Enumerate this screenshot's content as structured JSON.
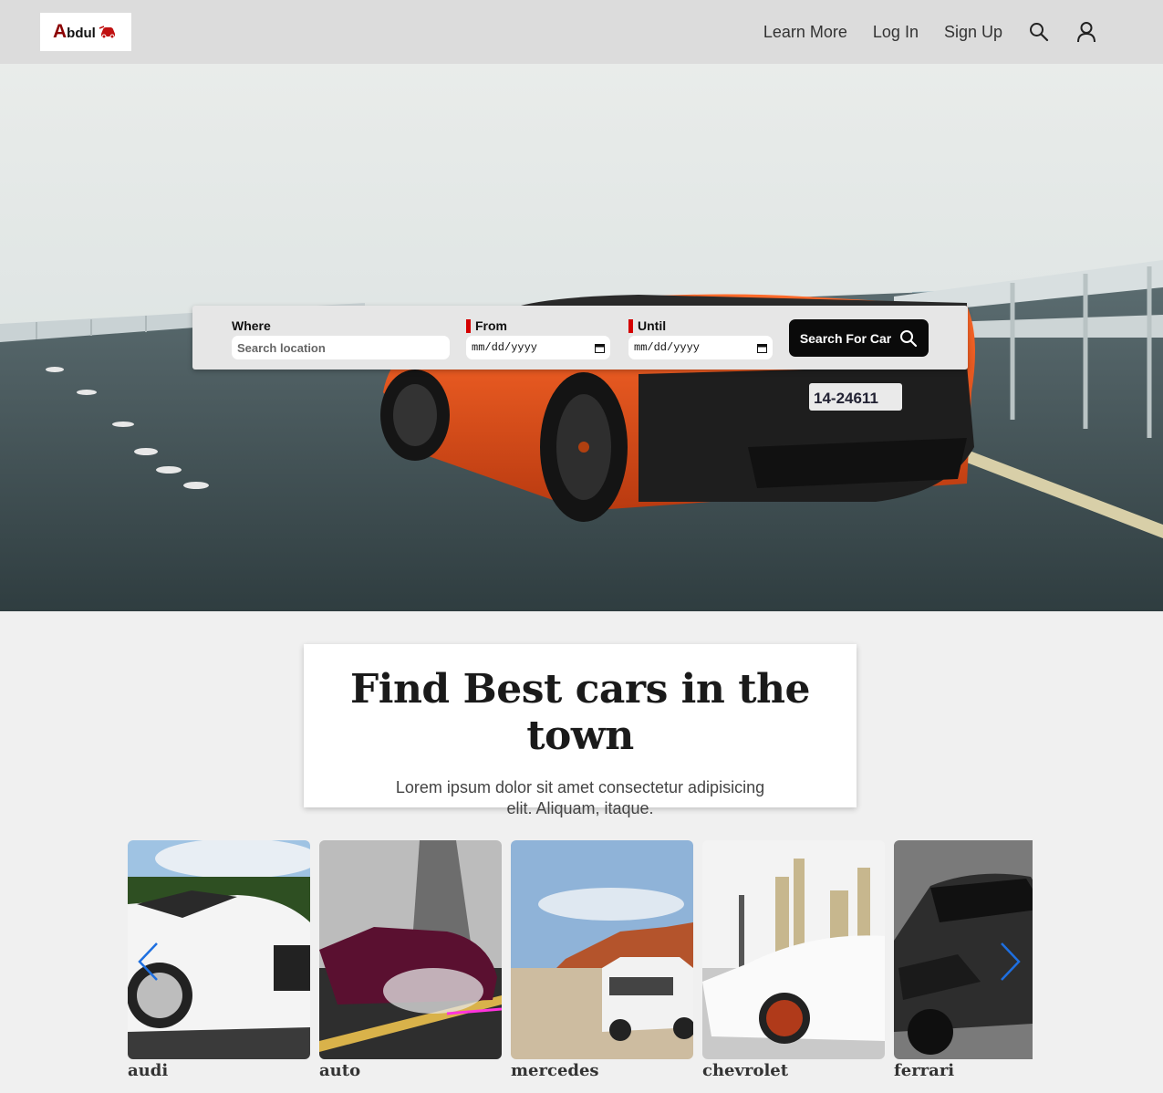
{
  "header": {
    "logo_text": "Abdul",
    "nav": [
      {
        "label": "Learn More"
      },
      {
        "label": "Log In"
      },
      {
        "label": "Sign Up"
      }
    ],
    "icons": [
      "search-icon",
      "user-icon"
    ]
  },
  "search": {
    "where_label": "Where",
    "where_placeholder": "Search location",
    "from_label": "From",
    "from_placeholder": "mm/dd/yyyy",
    "until_label": "Until",
    "until_placeholder": "mm/dd/yyyy",
    "button_label": "Search For Car"
  },
  "intro": {
    "title": "Find Best cars in the town",
    "text": "Lorem ipsum dolor sit amet consectetur adipisicing elit. Aliquam, itaque."
  },
  "cars": [
    {
      "label": "audi"
    },
    {
      "label": "auto"
    },
    {
      "label": "mercedes"
    },
    {
      "label": "chevrolet"
    },
    {
      "label": "ferrari"
    }
  ],
  "colors": {
    "header_bg": "#dcdcdc",
    "accent_red": "#d40000",
    "button_bg": "#0a0a0a",
    "arrow_blue": "#1e6fe0"
  }
}
